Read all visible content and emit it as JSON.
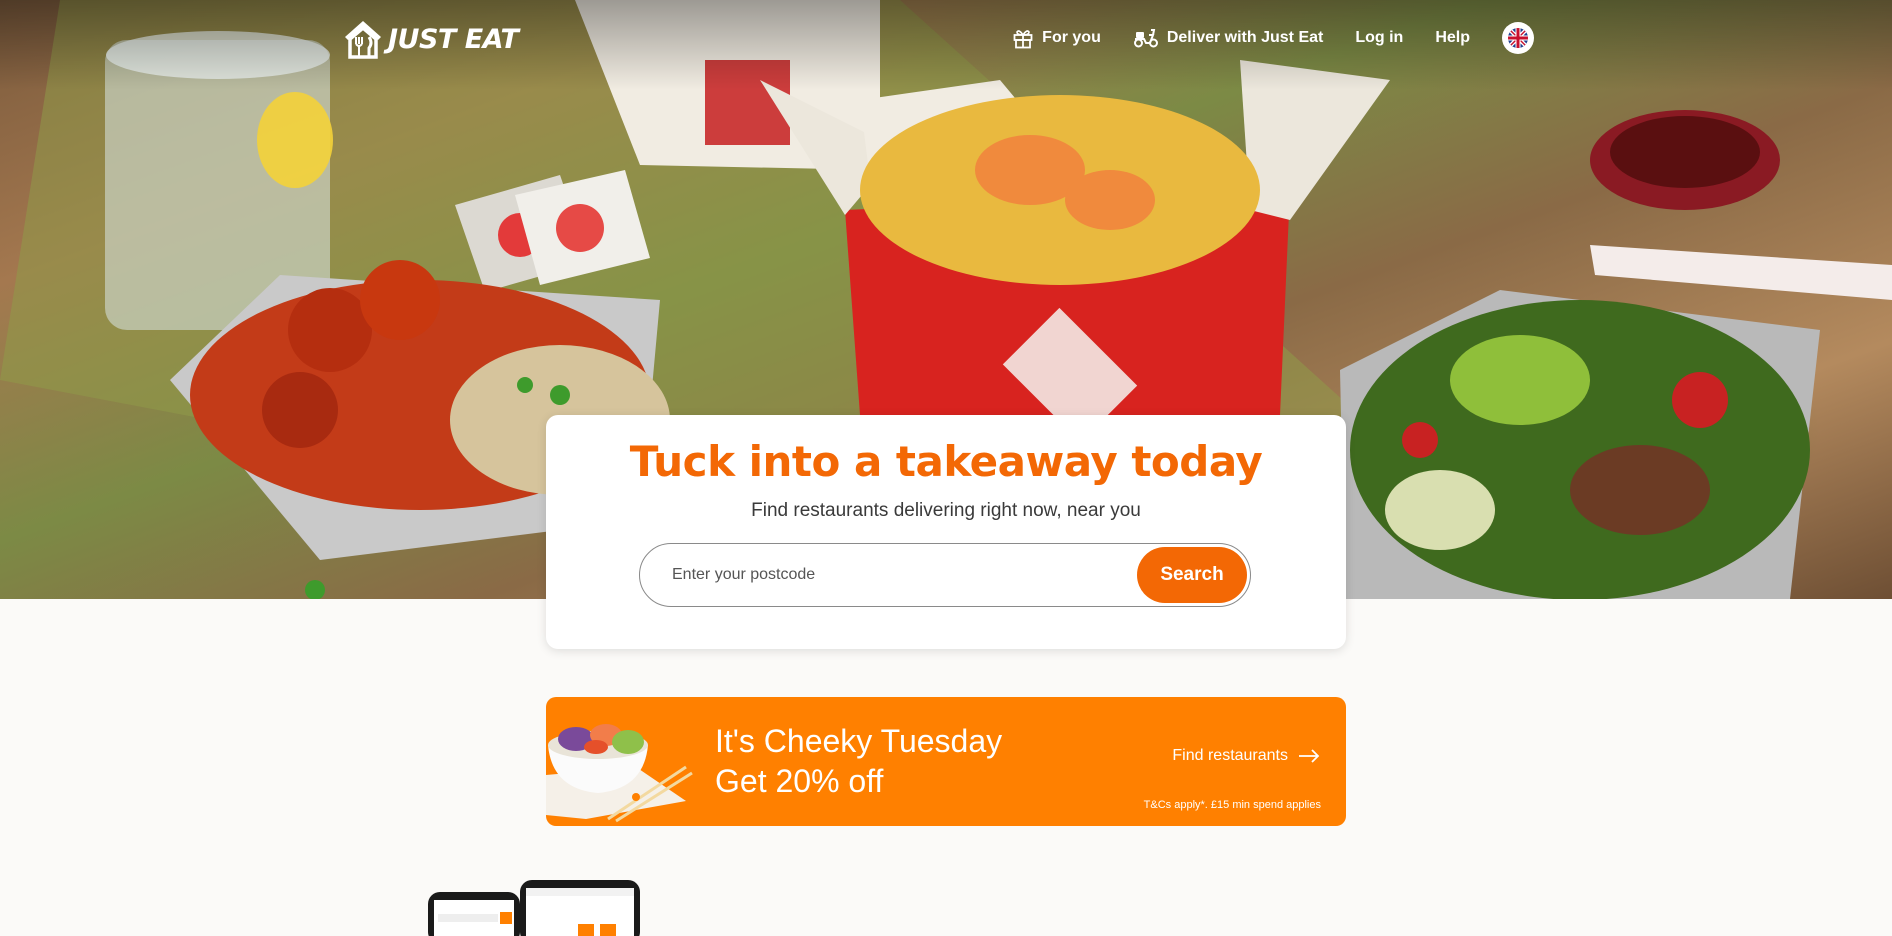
{
  "brand": {
    "name": "JUST EAT",
    "logo_icon": "house-fork-knife-icon",
    "color": "#f36805"
  },
  "nav": {
    "items": [
      {
        "label": "For you",
        "icon": "gift-icon"
      },
      {
        "label": "Deliver with Just Eat",
        "icon": "scooter-icon"
      },
      {
        "label": "Log in"
      },
      {
        "label": "Help"
      }
    ],
    "language_icon": "uk-flag-icon"
  },
  "hero": {
    "headline": "Tuck into a takeaway today",
    "subline": "Find restaurants delivering right now, near you",
    "search": {
      "placeholder": "Enter your postcode",
      "value": "",
      "button_label": "Search"
    }
  },
  "promo": {
    "title_line1": "It's Cheeky Tuesday",
    "title_line2": "Get 20% off",
    "link_label": "Find restaurants",
    "terms": "T&Cs apply*. £15 min spend applies",
    "background": "#ff8000"
  }
}
